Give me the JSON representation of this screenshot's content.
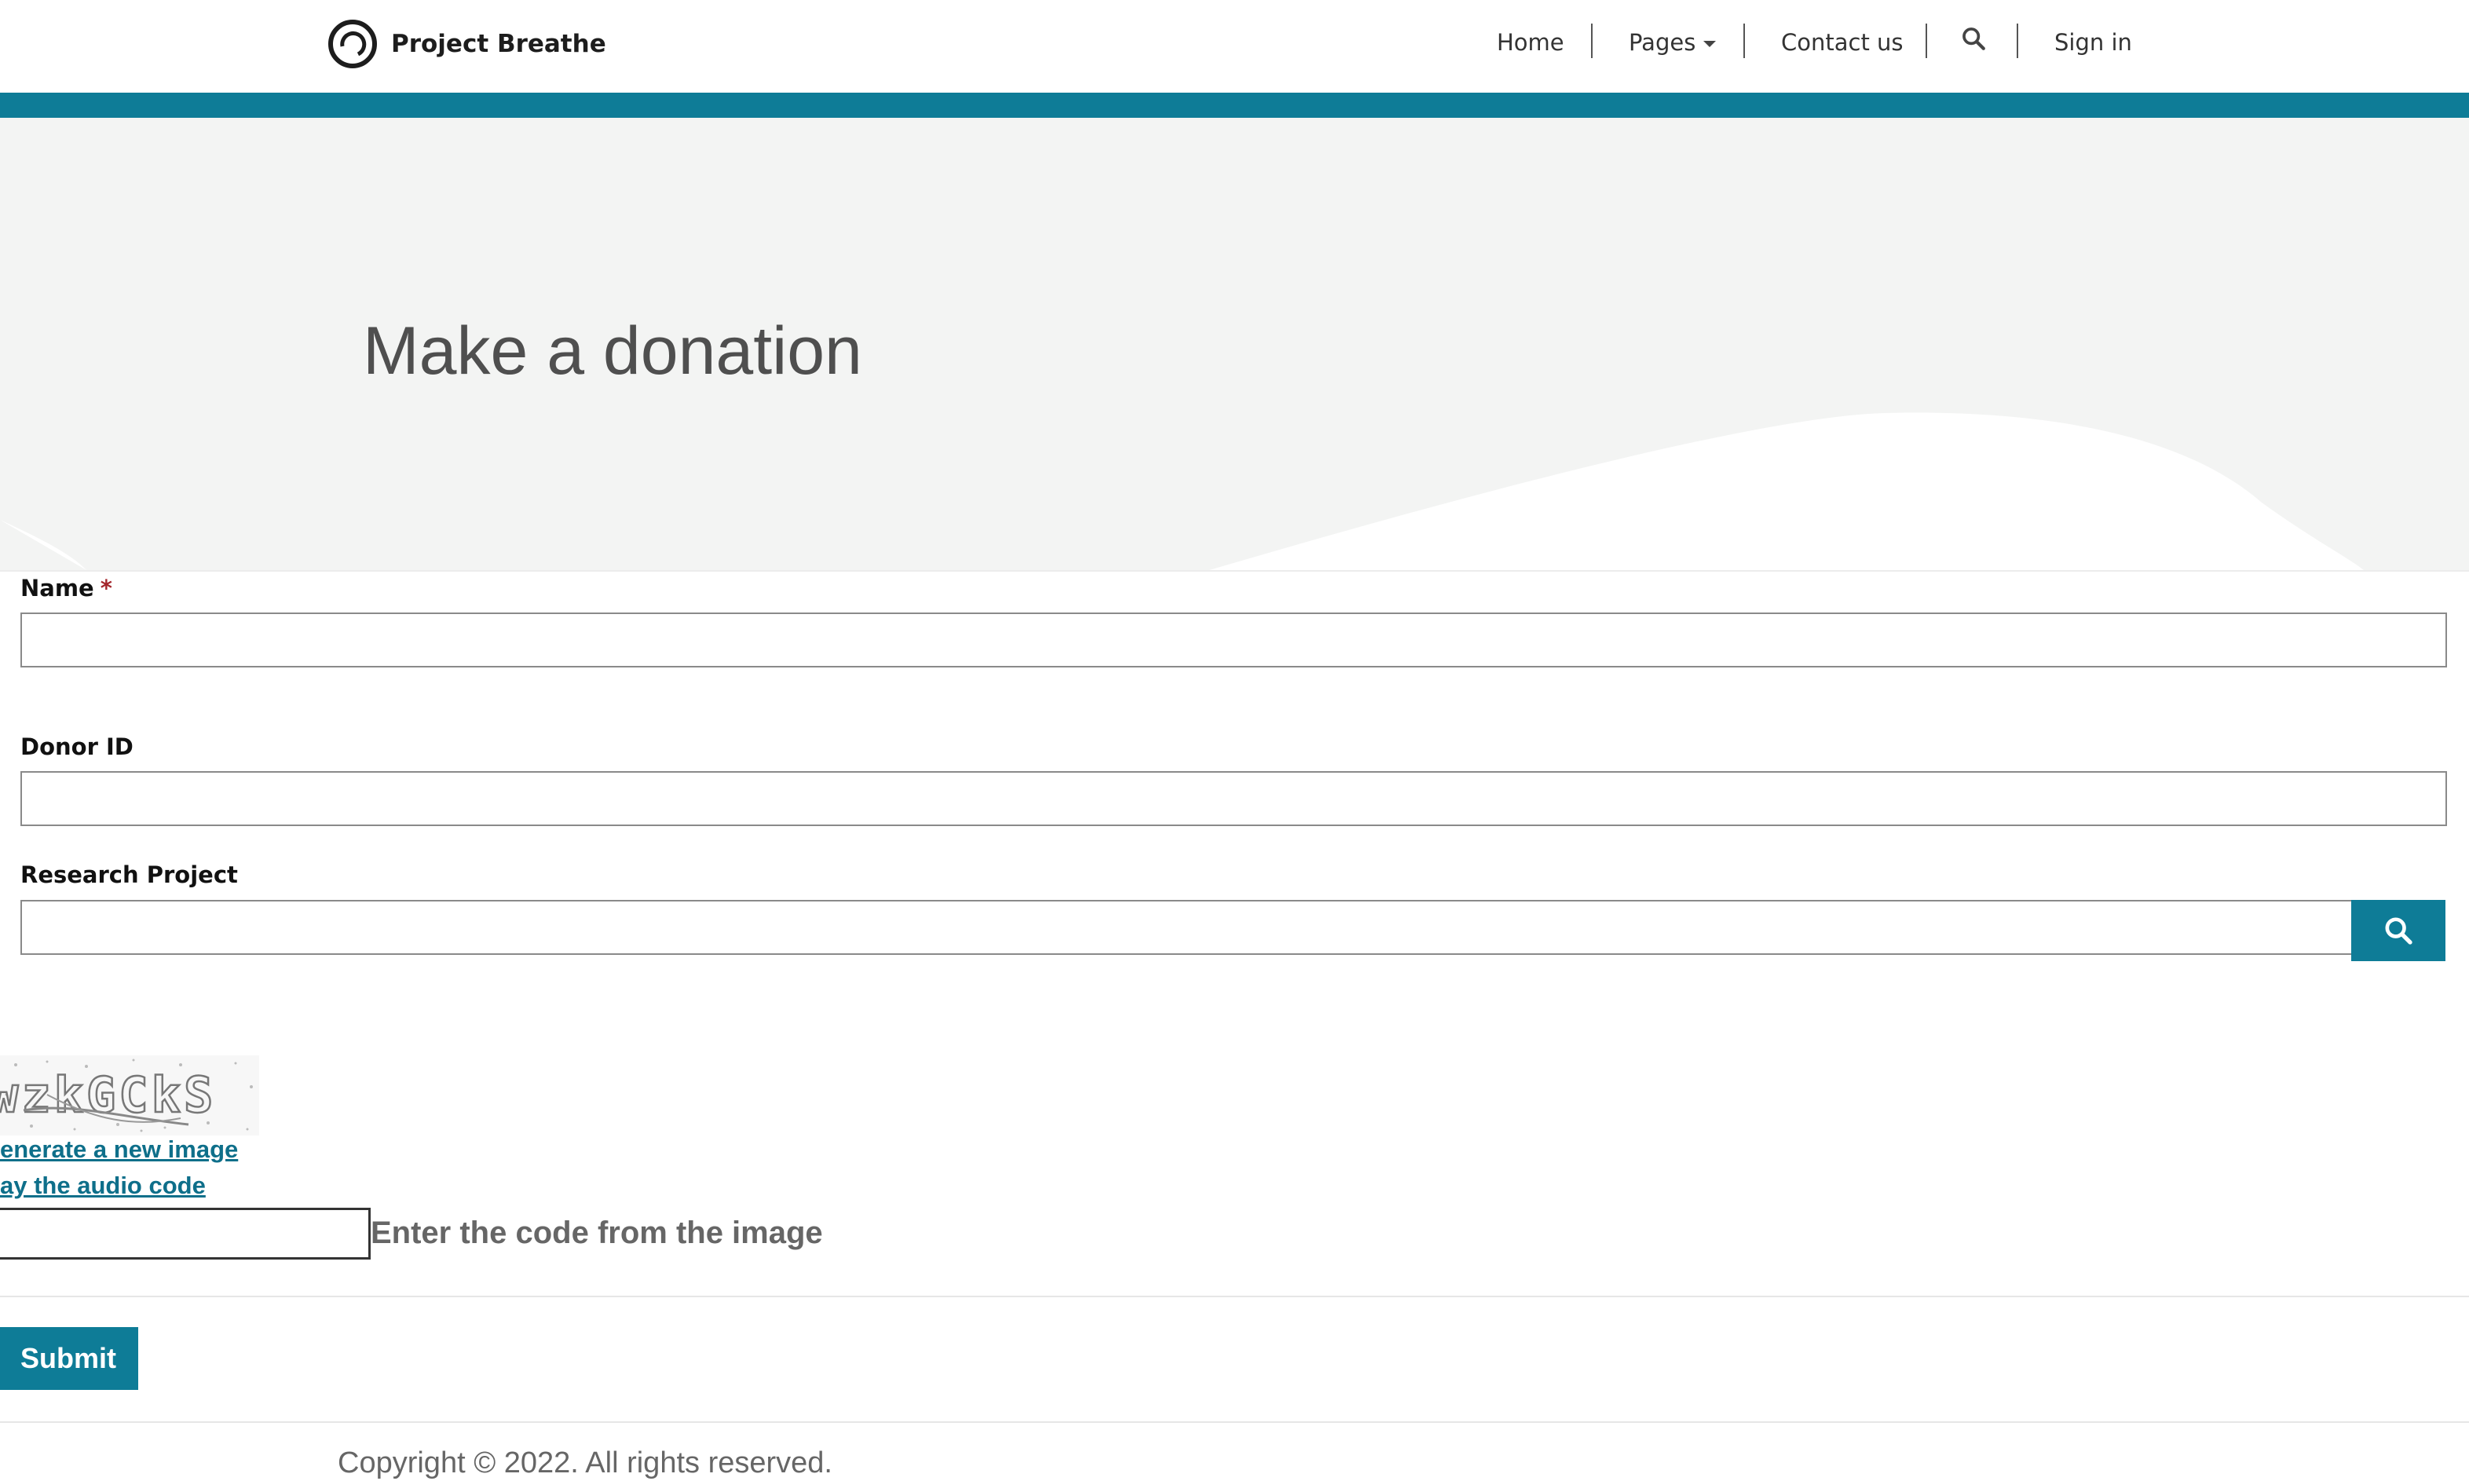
{
  "header": {
    "brand_name": "Project Breathe",
    "logo_icon": "ring-logo-icon",
    "nav": {
      "home": "Home",
      "pages": "Pages",
      "contact": "Contact us",
      "search_icon": "search-icon",
      "sign_in": "Sign in"
    }
  },
  "hero": {
    "title": "Make a donation"
  },
  "form": {
    "name_label": "Name",
    "required_mark": "*",
    "name_value": "",
    "donor_id_label": "Donor ID",
    "donor_id_value": "",
    "research_project_label": "Research Project",
    "research_project_value": "",
    "lookup_icon": "search-icon"
  },
  "captcha": {
    "image_text": "wzkGCkS",
    "new_image_link": "enerate a new image",
    "audio_link": "ay the audio code",
    "code_value": "",
    "hint": "Enter the code from the image"
  },
  "actions": {
    "submit_label": "Submit"
  },
  "footer": {
    "copyright": "Copyright © 2022. All rights reserved."
  },
  "colors": {
    "accent": "#0e7c97",
    "hero_bg": "#f3f4f3",
    "required": "#a4262c",
    "link": "#0e6f8a"
  }
}
